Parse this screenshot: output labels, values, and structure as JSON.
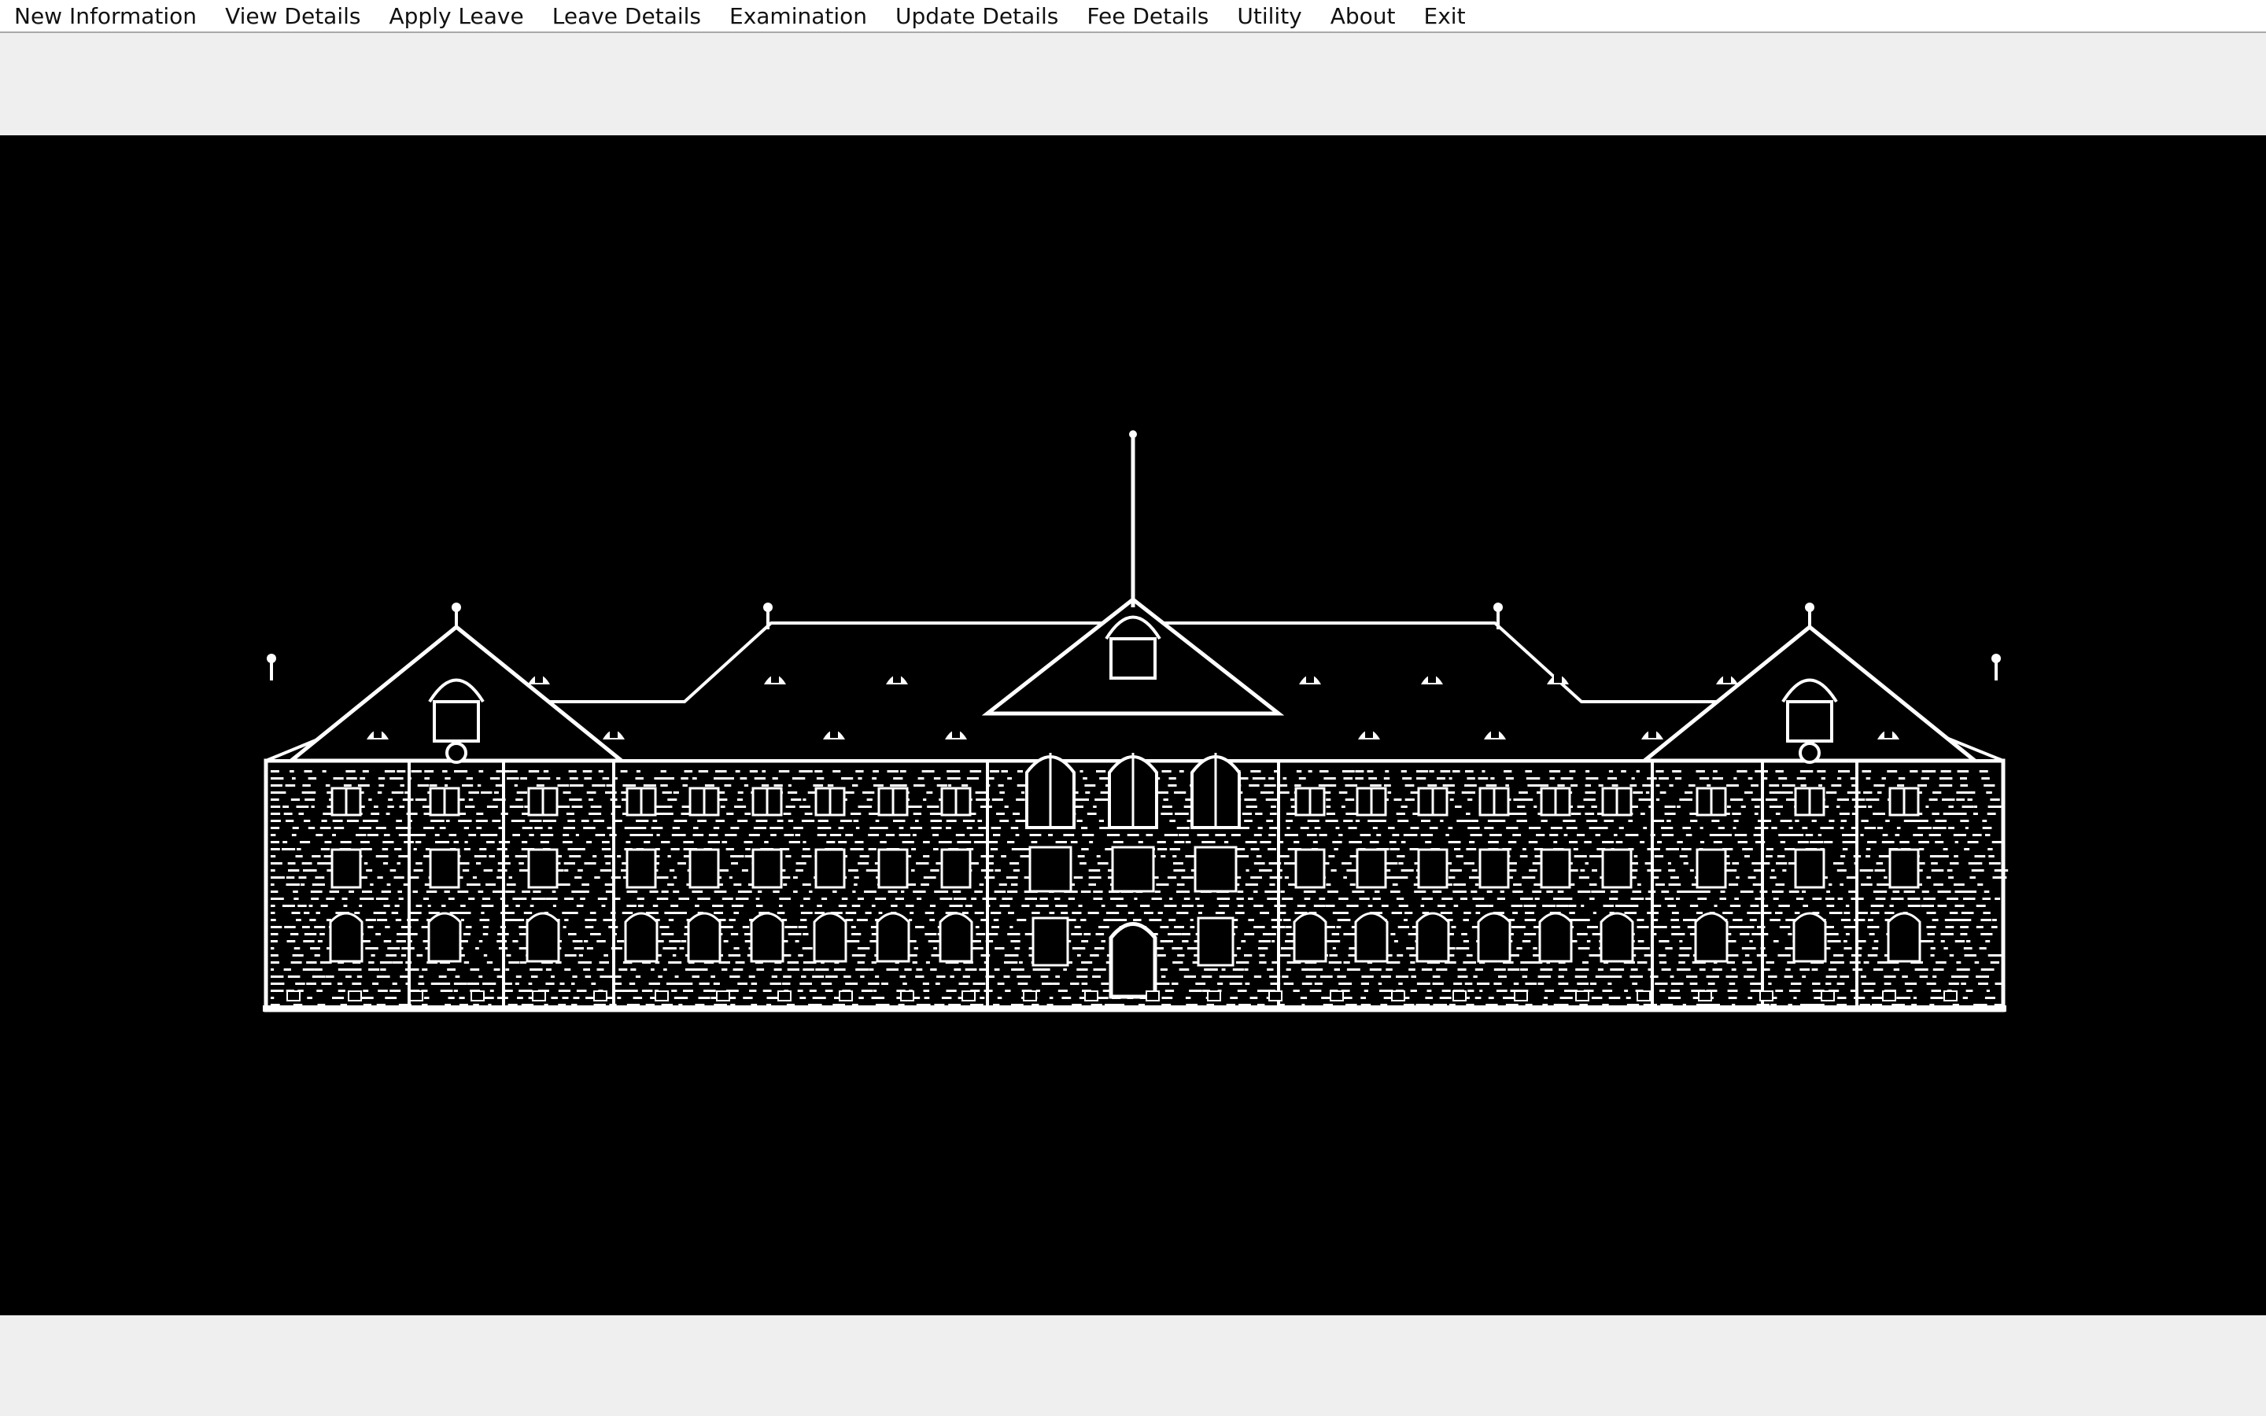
{
  "menubar": {
    "items": [
      {
        "label": "New Information"
      },
      {
        "label": "View Details"
      },
      {
        "label": "Apply Leave"
      },
      {
        "label": "Leave Details"
      },
      {
        "label": "Examination"
      },
      {
        "label": "Update Details"
      },
      {
        "label": "Fee Details"
      },
      {
        "label": "Utility"
      },
      {
        "label": "About"
      },
      {
        "label": "Exit"
      }
    ]
  },
  "background_image": {
    "subject": "building-drawing",
    "colors": {
      "background": "#000000",
      "line": "#ffffff"
    }
  }
}
